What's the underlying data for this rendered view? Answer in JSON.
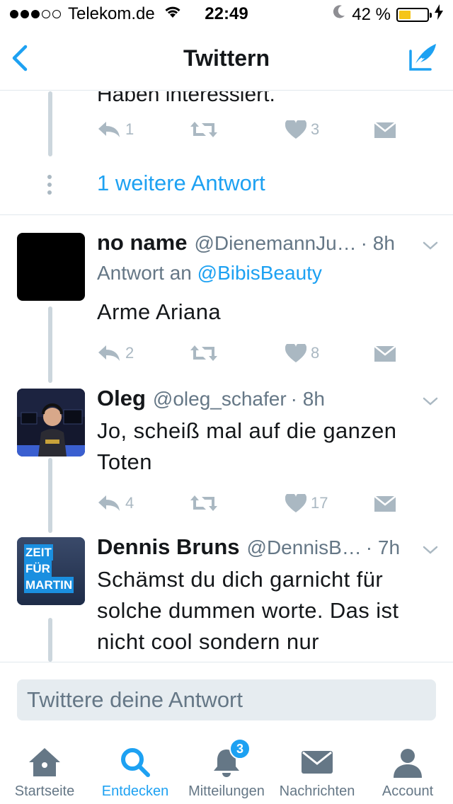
{
  "status_bar": {
    "carrier": "Telekom.de",
    "time": "22:49",
    "battery_percent": "42 %",
    "battery_level": 0.42
  },
  "nav": {
    "title": "Twittern"
  },
  "partial_tweet": {
    "cut_text": "Haben interessiert.",
    "reply_count": "1",
    "like_count": "3"
  },
  "more_replies": "1 weitere Antwort",
  "tweets": [
    {
      "name": "no name",
      "handle": "@DienemannJu…",
      "time": "· 8h",
      "reply_to_label": "Antwort an",
      "reply_to_handle": "@BibisBeauty",
      "text": "Arme Ariana",
      "reply_count": "2",
      "like_count": "8"
    },
    {
      "name": "Oleg",
      "handle": "@oleg_schafer",
      "time": "· 8h",
      "text": "Jo, scheiß mal auf die ganzen Toten",
      "reply_count": "4",
      "like_count": "17"
    },
    {
      "name": "Dennis Bruns",
      "handle": "@DennisB…",
      "time": "· 7h",
      "text": "Schämst du dich garnicht für solche dummen worte. Das ist nicht cool sondern nur",
      "avatar_text": [
        "ZEIT",
        "FÜR",
        "MARTIN"
      ]
    }
  ],
  "reply_box": {
    "placeholder": "Twittere deine Antwort"
  },
  "tabs": [
    {
      "label": "Startseite",
      "icon": "home-icon",
      "active": false
    },
    {
      "label": "Entdecken",
      "icon": "search-icon",
      "active": true
    },
    {
      "label": "Mitteilungen",
      "icon": "bell-icon",
      "active": false,
      "badge": "3"
    },
    {
      "label": "Nachrichten",
      "icon": "envelope-icon",
      "active": false
    },
    {
      "label": "Account",
      "icon": "person-icon",
      "active": false
    }
  ],
  "colors": {
    "accent": "#1da1f2",
    "icon_gray": "#aab8c2",
    "text_secondary": "#657786",
    "battery": "#f5c518"
  }
}
